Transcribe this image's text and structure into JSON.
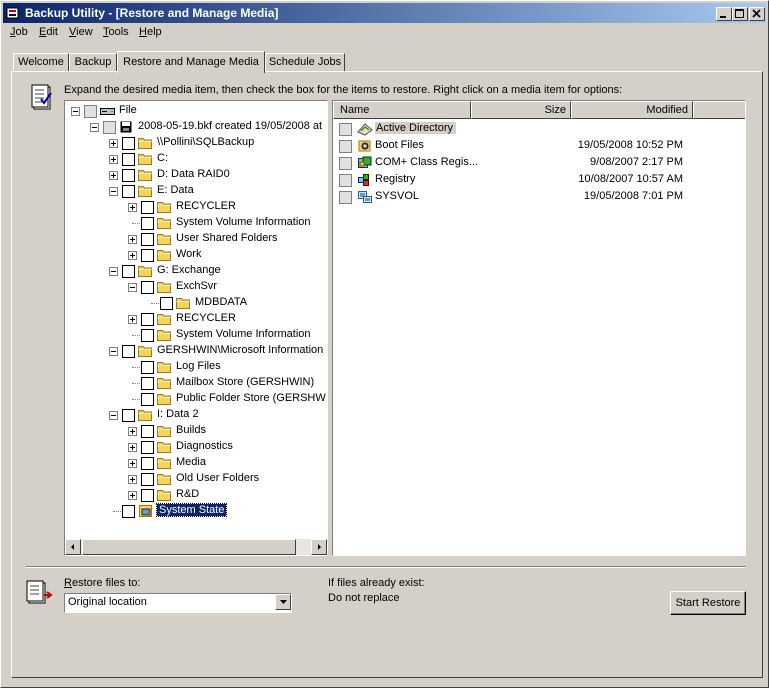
{
  "window": {
    "title": "Backup Utility - [Restore and Manage Media]"
  },
  "menu": [
    "Job",
    "Edit",
    "View",
    "Tools",
    "Help"
  ],
  "tabs": [
    "Welcome",
    "Backup",
    "Restore and Manage Media",
    "Schedule Jobs"
  ],
  "active_tab": "Restore and Manage Media",
  "instructions": "Expand the desired media item, then check the box for the items to restore. Right click on a media item for options:",
  "tree": [
    {
      "label": "File",
      "depth": 0,
      "expander": "minus",
      "checkbox": "grey",
      "icon": "drive"
    },
    {
      "label": "2008-05-19.bkf created 19/05/2008 at",
      "depth": 1,
      "expander": "minus",
      "checkbox": "grey",
      "icon": "tape"
    },
    {
      "label": "\\\\Pollini\\SQLBackup",
      "depth": 2,
      "expander": "plus",
      "checkbox": "white",
      "icon": "folder"
    },
    {
      "label": "C:",
      "depth": 2,
      "expander": "plus",
      "checkbox": "white",
      "icon": "folder"
    },
    {
      "label": "D: Data RAID0",
      "depth": 2,
      "expander": "plus",
      "checkbox": "white",
      "icon": "folder"
    },
    {
      "label": "E: Data",
      "depth": 2,
      "expander": "minus",
      "checkbox": "white",
      "icon": "folder"
    },
    {
      "label": "RECYCLER",
      "depth": 3,
      "expander": "plus",
      "checkbox": "white",
      "icon": "folder"
    },
    {
      "label": "System Volume Information",
      "depth": 3,
      "expander": "none",
      "checkbox": "white",
      "icon": "folder"
    },
    {
      "label": "User Shared Folders",
      "depth": 3,
      "expander": "plus",
      "checkbox": "white",
      "icon": "folder"
    },
    {
      "label": "Work",
      "depth": 3,
      "expander": "plus",
      "checkbox": "white",
      "icon": "folder"
    },
    {
      "label": "G: Exchange",
      "depth": 2,
      "expander": "minus",
      "checkbox": "white",
      "icon": "folder"
    },
    {
      "label": "ExchSvr",
      "depth": 3,
      "expander": "minus",
      "checkbox": "white",
      "icon": "folder"
    },
    {
      "label": "MDBDATA",
      "depth": 4,
      "expander": "none",
      "checkbox": "white",
      "icon": "folder"
    },
    {
      "label": "RECYCLER",
      "depth": 3,
      "expander": "plus",
      "checkbox": "white",
      "icon": "folder"
    },
    {
      "label": "System Volume Information",
      "depth": 3,
      "expander": "none",
      "checkbox": "white",
      "icon": "folder"
    },
    {
      "label": "GERSHWIN\\Microsoft Information",
      "depth": 2,
      "expander": "minus",
      "checkbox": "white",
      "icon": "folder"
    },
    {
      "label": "Log Files",
      "depth": 3,
      "expander": "none",
      "checkbox": "white",
      "icon": "folder"
    },
    {
      "label": "Mailbox Store (GERSHWIN)",
      "depth": 3,
      "expander": "none",
      "checkbox": "white",
      "icon": "folder"
    },
    {
      "label": "Public Folder Store (GERSHW",
      "depth": 3,
      "expander": "none",
      "checkbox": "white",
      "icon": "folder"
    },
    {
      "label": "I: Data 2",
      "depth": 2,
      "expander": "minus",
      "checkbox": "white",
      "icon": "folder"
    },
    {
      "label": "Builds",
      "depth": 3,
      "expander": "plus",
      "checkbox": "white",
      "icon": "folder"
    },
    {
      "label": "Diagnostics",
      "depth": 3,
      "expander": "plus",
      "checkbox": "white",
      "icon": "folder"
    },
    {
      "label": "Media",
      "depth": 3,
      "expander": "plus",
      "checkbox": "white",
      "icon": "folder"
    },
    {
      "label": "Old User Folders",
      "depth": 3,
      "expander": "plus",
      "checkbox": "white",
      "icon": "folder"
    },
    {
      "label": "R&D",
      "depth": 3,
      "expander": "plus",
      "checkbox": "white",
      "icon": "folder"
    },
    {
      "label": "System State",
      "depth": 2,
      "expander": "none",
      "checkbox": "white",
      "icon": "system-state",
      "selected": true
    }
  ],
  "list": {
    "columns": [
      "Name",
      "Size",
      "Modified"
    ],
    "rows": [
      {
        "name": "Active Directory",
        "size": "",
        "modified": "",
        "icon": "active-directory"
      },
      {
        "name": "Boot Files",
        "size": "",
        "modified": "19/05/2008 10:52 PM",
        "icon": "boot-files"
      },
      {
        "name": "COM+ Class Regis...",
        "size": "",
        "modified": "9/08/2007 2:17 PM",
        "icon": "com-class"
      },
      {
        "name": "Registry",
        "size": "",
        "modified": "10/08/2007 10:57 AM",
        "icon": "registry"
      },
      {
        "name": "SYSVOL",
        "size": "",
        "modified": "19/05/2008 7:01 PM",
        "icon": "sysvol"
      }
    ]
  },
  "restore": {
    "label": "Restore files to:",
    "value": "Original location",
    "exist_label": "If files already exist:",
    "exist_value": "Do not replace",
    "start_button": "Start Restore"
  }
}
